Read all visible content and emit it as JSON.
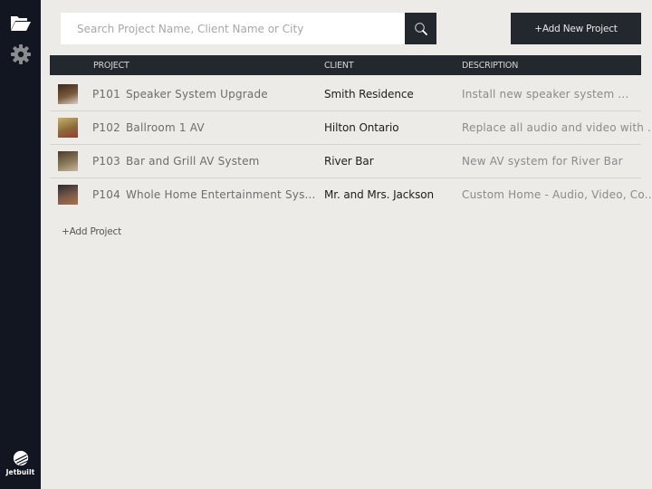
{
  "sidebar": {
    "icons": [
      "folder-open-icon",
      "gear-icon"
    ],
    "logo_text": "Jetbuilt"
  },
  "search": {
    "placeholder": "Search Project Name, Client Name or City",
    "value": "",
    "button_icon": "search-icon"
  },
  "toolbar": {
    "add_new_project_label": "+Add New Project"
  },
  "table": {
    "columns": [
      "PROJECT",
      "CLIENT",
      "DESCRIPTION"
    ],
    "rows": [
      {
        "code": "P101",
        "name": "Speaker System Upgrade",
        "client": "Smith Residence",
        "description": "Install new speaker system ...",
        "thumb_colors": [
          "#3a2a1e",
          "#7a5a3a",
          "#d8d0c4"
        ]
      },
      {
        "code": "P102",
        "name": "Ballroom 1 AV",
        "client": "Hilton Ontario",
        "description": "Replace all audio and video with ...",
        "thumb_colors": [
          "#c9b26a",
          "#8a6a3a",
          "#9a3a2a"
        ]
      },
      {
        "code": "P103",
        "name": "Bar and Grill AV System",
        "client": "River Bar",
        "description": "New AV system for River Bar",
        "thumb_colors": [
          "#4a3a2a",
          "#8a7a5a",
          "#c8b89a"
        ]
      },
      {
        "code": "P104",
        "name": "Whole Home Entertainment Sys...",
        "client": "Mr. and Mrs. Jackson",
        "description": "Custom Home - Audio, Video, Co...",
        "thumb_colors": [
          "#2a2a2e",
          "#7a5a4a",
          "#b07040"
        ]
      }
    ]
  },
  "footer": {
    "add_project_label": "+Add Project"
  }
}
